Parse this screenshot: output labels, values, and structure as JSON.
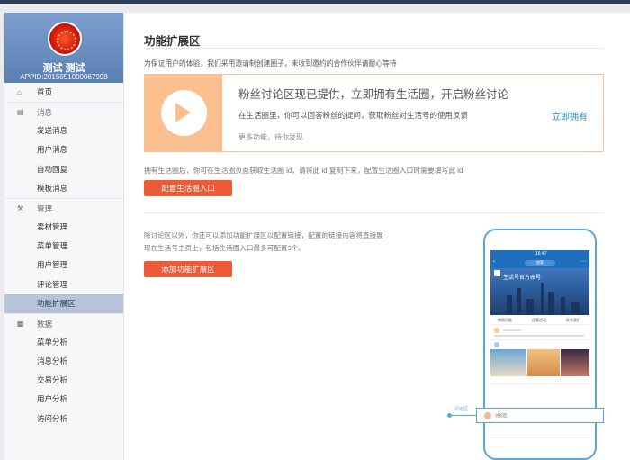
{
  "profile": {
    "name": "测试 测试",
    "appid": "APPID:2015051000067998"
  },
  "sidebar": {
    "home": "首页",
    "groups": [
      {
        "title": "消息",
        "items": [
          "发送消息",
          "用户消息",
          "自动回复",
          "模板消息"
        ]
      },
      {
        "title": "管理",
        "items": [
          "素材管理",
          "菜单管理",
          "用户管理",
          "评论管理",
          "功能扩展区"
        ]
      },
      {
        "title": "数据",
        "items": [
          "菜单分析",
          "消息分析",
          "交易分析",
          "用户分析",
          "访问分析"
        ]
      }
    ],
    "active_item": "功能扩展区"
  },
  "main": {
    "title": "功能扩展区",
    "description": "为保证用户的体验，我们采用邀请制创建圈子，未收到邀约的合作伙伴请耐心等待",
    "promo": {
      "title": "粉丝讨论区现已提供，立即拥有生活圈，开启粉丝讨论",
      "text": "在生活圈里，你可以回答粉丝的提问，获取粉丝对生活号的使用反馈",
      "more": "更多功能，待你发现",
      "link": "立即拥有"
    },
    "hint1": "拥有生活圈后，你可在生活圈页面获取生活圈 id，请将此 id 复制下来，配置生活圈入口时需要填写此 id",
    "button1": "配置生活圈入口",
    "hint2_line1": "除讨论区以外，你还可以添加功能扩展区以配置链接，配置的链接内容将直接展",
    "hint2_line2": "现在生活号主页上，包括生活圈入口最多可配置3个。",
    "button2": "添加功能扩展区"
  },
  "phone": {
    "time": "16:47",
    "search": "搜索",
    "hero_title": "生活号官方账号",
    "tabs": [
      "常用功能",
      "优惠活动",
      "联系我们"
    ],
    "callout": "讨论区",
    "popup_text": "讨论区"
  },
  "colors": {
    "accent": "#ee5a35",
    "promo_bg": "#fbbf90",
    "link": "#2a8ad4",
    "active_menu": "#b6c3d8",
    "phone_frame": "#5aa6e3"
  },
  "icons": {
    "home": "home-icon",
    "message": "message-icon",
    "manage": "wrench-icon",
    "data": "bar-chart-icon",
    "promo": "play-circle-icon"
  }
}
